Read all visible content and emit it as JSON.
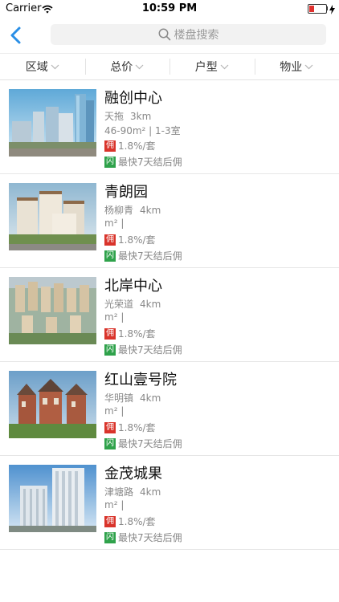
{
  "status_bar": {
    "carrier": "Carrier",
    "time": "10:59 PM",
    "battery_level": 0.3
  },
  "nav": {
    "search_placeholder": "楼盘搜索"
  },
  "filters": [
    {
      "label": "区域"
    },
    {
      "label": "总价"
    },
    {
      "label": "户型"
    },
    {
      "label": "物业"
    }
  ],
  "tags": {
    "commission": "佣",
    "fast": "闪"
  },
  "listings": [
    {
      "name": "融创中心",
      "area": "天拖",
      "distance": "3km",
      "spec": "46-90m² | 1-3室",
      "commission": "1.8%/套",
      "fast_note": "最快7天结后佣"
    },
    {
      "name": "青朗园",
      "area": "杨柳青",
      "distance": "4km",
      "spec": "m² |",
      "commission": "1.8%/套",
      "fast_note": "最快7天结后佣"
    },
    {
      "name": "北岸中心",
      "area": "光荣道",
      "distance": "4km",
      "spec": "m² |",
      "commission": "1.8%/套",
      "fast_note": "最快7天结后佣"
    },
    {
      "name": "红山壹号院",
      "area": "华明镇",
      "distance": "4km",
      "spec": "m² |",
      "commission": "1.8%/套",
      "fast_note": "最快7天结后佣"
    },
    {
      "name": "金茂城果",
      "area": "津塘路",
      "distance": "4km",
      "spec": "m² |",
      "commission": "1.8%/套",
      "fast_note": "最快7天结后佣"
    }
  ]
}
